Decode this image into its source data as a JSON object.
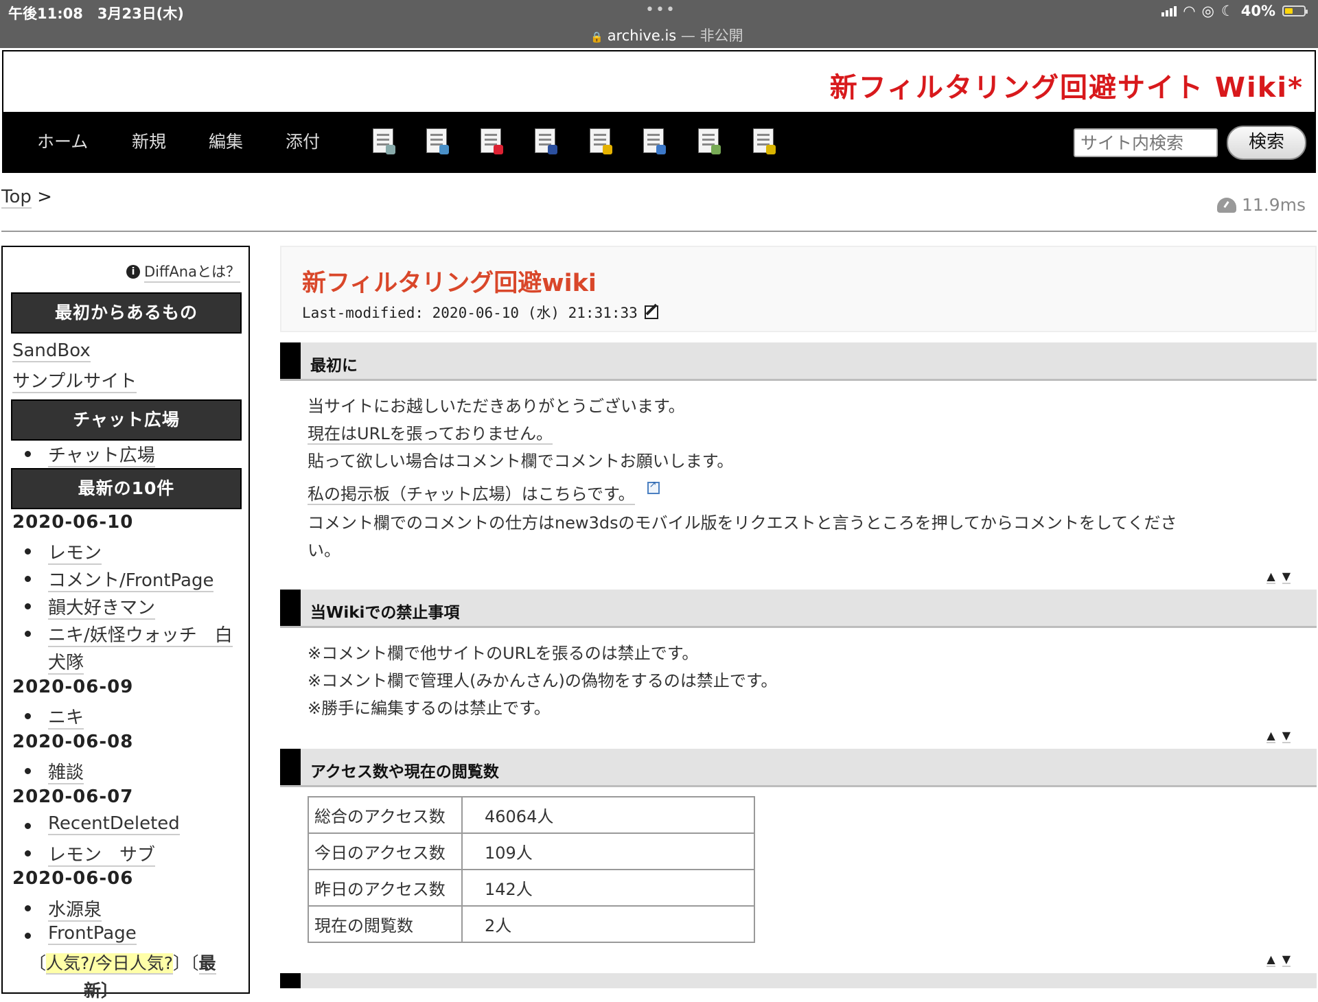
{
  "status_bar": {
    "time": "午後11:08　3月23日(木)",
    "url": "archive.is",
    "url_suffix": " — 非公開",
    "battery": "40%"
  },
  "site": {
    "title": "新フィルタリング回避サイト Wiki*"
  },
  "nav": {
    "items": [
      "ホーム",
      "新規",
      "編集",
      "添付"
    ],
    "tool_icons": [
      "copy-icon",
      "search-page-icon",
      "download-icon",
      "save-icon",
      "lock-icon",
      "duplicate-icon",
      "list-icon",
      "help-icon"
    ],
    "search_placeholder": "サイト内検索",
    "search_button": "検索"
  },
  "breadcrumb": {
    "top": "Top",
    "sep": ">"
  },
  "timing": "11.9ms",
  "sidebar": {
    "diffana": "DiffAnaとは？",
    "head1": "最初からあるもの",
    "links1": [
      "SandBox",
      "サンプルサイト"
    ],
    "head2": "チャット広場",
    "chat_link": "チャット広場",
    "head3": "最新の10件",
    "groups": [
      {
        "date": "2020-06-10",
        "items": [
          "レモン",
          "コメント/FrontPage",
          "韻大好きマン",
          "ニキ/妖怪ウォッチ　白",
          "犬隊"
        ]
      },
      {
        "date": "2020-06-09",
        "items": [
          "ニキ"
        ]
      },
      {
        "date": "2020-06-08",
        "items": [
          "雑談"
        ]
      },
      {
        "date": "2020-06-07",
        "items": [
          "RecentDeleted",
          "レモン　サブ"
        ]
      },
      {
        "date": "2020-06-06",
        "items": [
          "水源泉",
          "FrontPage"
        ]
      }
    ],
    "popular_open": "〔",
    "popular": "人気?/今日人気?",
    "popular_close": "〕〔",
    "latest": "最",
    "latest2": "新〕"
  },
  "page": {
    "title": "新フィルタリング回避wiki",
    "last_modified": "Last-modified: 2020-06-10 (水) 21:31:33"
  },
  "sections": [
    {
      "heading": "最初に",
      "lines": [
        "当サイトにお越しいただきありがとうございます。",
        "現在はURLを張っておりません。",
        "貼って欲しい場合はコメント欄でコメントお願いします。",
        "私の掲示板（チャット広場）はこちらです。",
        "コメント欄でのコメントの仕方はnew3dsのモバイル版をリクエストと言うところを押してからコメントをしてくださ",
        "い。"
      ]
    },
    {
      "heading": "当Wikiでの禁止事項",
      "lines": [
        "※コメント欄で他サイトのURLを張るのは禁止です。",
        "※コメント欄で管理人(みかんさん)の偽物をするのは禁止です。",
        "※勝手に編集するのは禁止です。"
      ]
    },
    {
      "heading": "アクセス数や現在の閲覧数",
      "table": [
        [
          "総合のアクセス数",
          "46064人"
        ],
        [
          "今日のアクセス数",
          "109人"
        ],
        [
          "昨日のアクセス数",
          "142人"
        ],
        [
          "現在の閲覧数",
          "2人"
        ]
      ]
    }
  ],
  "arrows": {
    "up": "▲",
    "down": "▼"
  }
}
